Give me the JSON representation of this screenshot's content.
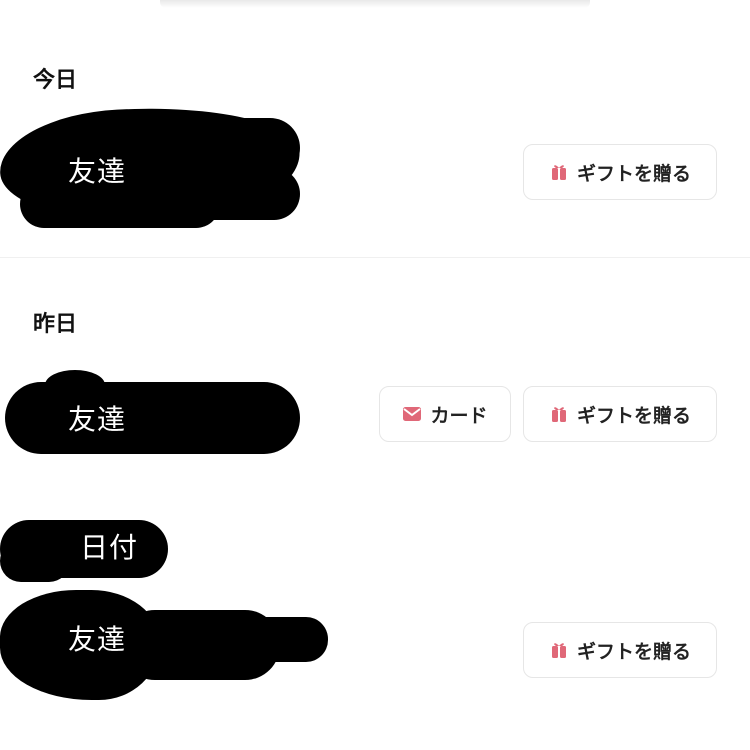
{
  "sections": {
    "today": {
      "title": "今日"
    },
    "yesterday": {
      "title": "昨日"
    }
  },
  "entries": {
    "today_1": {
      "name": "友達",
      "gift_label": "ギフトを贈る"
    },
    "yesterday_1": {
      "name": "友達",
      "card_label": "カード",
      "gift_label": "ギフトを贈る"
    },
    "dated_1": {
      "date_label": "日付",
      "name": "友達",
      "gift_label": "ギフトを贈る"
    }
  },
  "colors": {
    "accent": "#e06878",
    "border": "#e6e6e6",
    "redaction": "#000000"
  },
  "icons": {
    "gift": "gift-icon",
    "card": "envelope-icon"
  }
}
